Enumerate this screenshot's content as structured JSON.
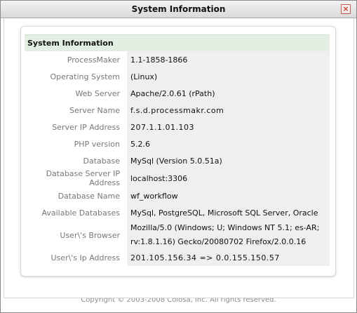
{
  "window": {
    "title": "System Information"
  },
  "section": {
    "title": "System Information"
  },
  "rows": [
    {
      "label": "ProcessMaker",
      "value": "1.1-1858-1866"
    },
    {
      "label": "Operating System",
      "value": "(Linux)"
    },
    {
      "label": "Web Server",
      "value": "Apache/2.0.61 (rPath)"
    },
    {
      "label": "Server Name",
      "value": "f.s.d.processmakr.com"
    },
    {
      "label": "Server IP Address",
      "value": "207.1.1.01.103"
    },
    {
      "label": "PHP version",
      "value": "5.2.6"
    },
    {
      "label": "Database",
      "value": "MySql (Version 5.0.51a)"
    },
    {
      "label": "Database Server IP Address",
      "value": "localhost:3306"
    },
    {
      "label": "Database Name",
      "value": "wf_workflow"
    },
    {
      "label": "Available Databases",
      "value": "MySql, PostgreSQL, Microsoft SQL Server, Oracle"
    },
    {
      "label": "User\\'s Browser",
      "value_line1": "Mozilla/5.0 (Windows; U; Windows NT 5.1; es-AR;",
      "value_line2": "rv:1.8.1.16) Gecko/20080702 Firefox/2.0.0.16"
    },
    {
      "label": "User\\'s Ip Address",
      "value": "201.105.156.34 => 0.0.155.150.57"
    }
  ],
  "footer": {
    "text": "Copyright © 2003-2008 Colosa, Inc. All rights reserved."
  },
  "icons": {
    "close": "close-icon"
  }
}
